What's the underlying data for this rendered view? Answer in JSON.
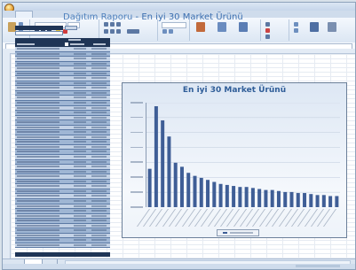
{
  "report": {
    "title_prefix": "Dağıtım Raporu",
    "title_sep": " - ",
    "title_main": "En iyi 30 Market Ürünü"
  },
  "chart": {
    "title": "En iyi 30 Market Ürünü"
  },
  "colors": {
    "table_header": "#1f3556",
    "bar": "#3f5e96",
    "title_blue": "#4f81bd"
  },
  "chart_data": {
    "type": "bar",
    "title": "En iyi 30 Market Ürünü",
    "categories": [],
    "values": [
      38,
      100,
      86,
      70,
      44,
      40,
      34,
      31,
      29,
      27,
      25,
      23,
      22,
      21,
      20,
      20,
      19,
      18,
      17,
      17,
      16,
      15,
      15,
      14,
      14,
      13,
      12,
      12,
      11,
      11
    ],
    "ylim": [
      0,
      100
    ]
  },
  "icons": {
    "office_button": "office-button-icon"
  }
}
